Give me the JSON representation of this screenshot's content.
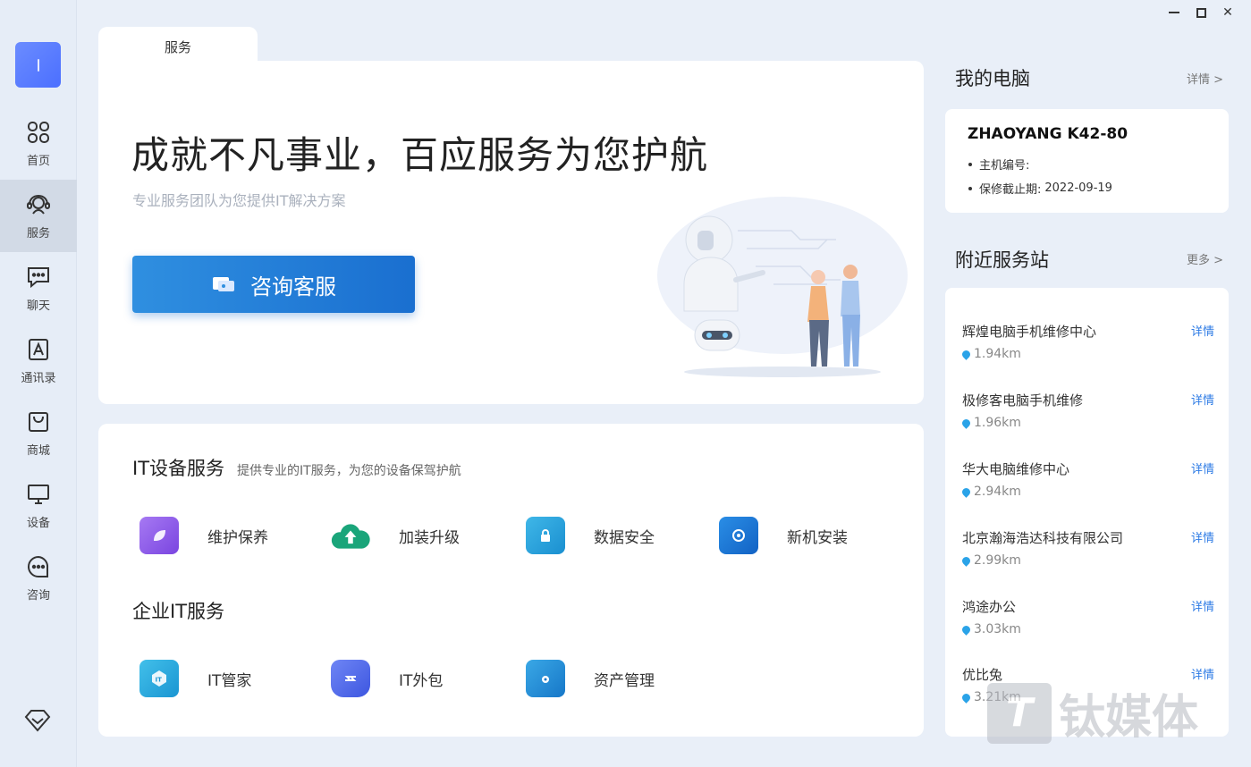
{
  "window": {
    "controls": [
      "minimize",
      "maximize",
      "close"
    ]
  },
  "sidebar": {
    "items": [
      {
        "label": "首页",
        "icon": "home-grid-icon",
        "active": false
      },
      {
        "label": "服务",
        "icon": "service-agent-icon",
        "active": true
      },
      {
        "label": "聊天",
        "icon": "chat-icon",
        "active": false
      },
      {
        "label": "通讯录",
        "icon": "contacts-icon",
        "active": false
      },
      {
        "label": "商城",
        "icon": "shop-bag-icon",
        "active": false
      },
      {
        "label": "设备",
        "icon": "device-monitor-icon",
        "active": false
      },
      {
        "label": "咨询",
        "icon": "consult-icon",
        "active": false
      }
    ]
  },
  "tab": {
    "label": "服务"
  },
  "hero": {
    "title": "成就不凡事业，百应服务为您护航",
    "subtitle": "专业服务团队为您提供IT解决方案",
    "button_label": "咨询客服"
  },
  "it_services": {
    "title": "IT设备服务",
    "description": "提供专业的IT服务，为您的设备保驾护航",
    "items": [
      {
        "label": "维护保养",
        "icon": "leaf-icon",
        "color": "#8b57e8"
      },
      {
        "label": "加装升级",
        "icon": "upgrade-cloud-icon",
        "color": "#1aa57a"
      },
      {
        "label": "数据安全",
        "icon": "lock-folder-icon",
        "color": "#1e9ad6"
      },
      {
        "label": "新机安装",
        "icon": "install-monitor-icon",
        "color": "#1875d1"
      }
    ]
  },
  "enterprise_services": {
    "title": "企业IT服务",
    "items": [
      {
        "label": "IT管家",
        "icon": "it-steward-icon",
        "color": "#23a8d8"
      },
      {
        "label": "IT外包",
        "icon": "outsource-icon",
        "color": "#4f69e8"
      },
      {
        "label": "资产管理",
        "icon": "asset-folder-icon",
        "color": "#1d8fd6"
      }
    ]
  },
  "my_pc": {
    "title": "我的电脑",
    "more": "详情 >",
    "model": "ZHAOYANG K42-80",
    "host_label": "主机编号:",
    "warranty_label": "保修截止期:",
    "warranty_date": "2022-09-19"
  },
  "stations": {
    "title": "附近服务站",
    "more": "更多 >",
    "detail_label": "详情",
    "items": [
      {
        "name": "辉煌电脑手机维修中心",
        "distance": "1.94km"
      },
      {
        "name": "极修客电脑手机维修",
        "distance": "1.96km"
      },
      {
        "name": "华大电脑维修中心",
        "distance": "2.94km"
      },
      {
        "name": "北京瀚海浩达科技有限公司",
        "distance": "2.99km"
      },
      {
        "name": "鸿途办公",
        "distance": "3.03km"
      },
      {
        "name": "优比兔",
        "distance": "3.21km"
      }
    ]
  },
  "watermark": {
    "text": "钛媒体",
    "logo": "T"
  }
}
